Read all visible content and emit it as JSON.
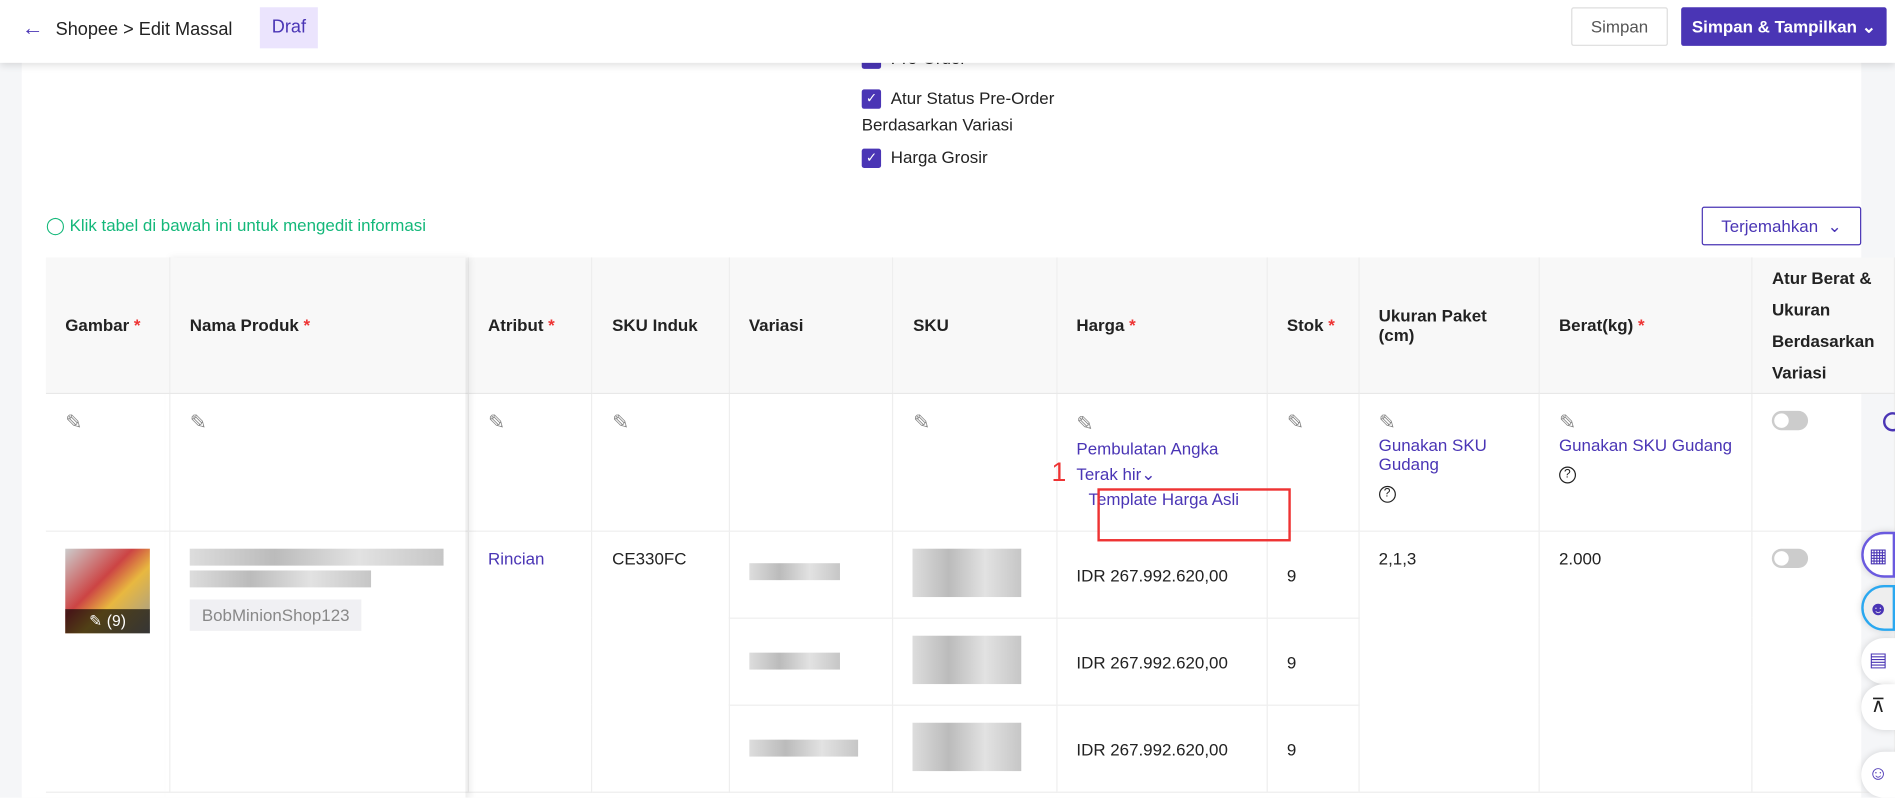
{
  "header": {
    "breadcrumb": "Shopee > Edit Massal",
    "status_badge": "Draf",
    "save_label": "Simpan",
    "save_show_label": "Simpan & Tampilkan"
  },
  "options": [
    {
      "label": "Pre-Order",
      "checked": true
    },
    {
      "label": "Atur Status Pre-Order",
      "label2": "Berdasarkan Variasi",
      "checked": true
    },
    {
      "label": "Harga Grosir",
      "checked": true
    }
  ],
  "tip": "Klik tabel di bawah ini untuk mengedit informasi",
  "translate_label": "Terjemahkan",
  "columns": [
    "Gambar",
    "Nama Produk",
    "Atribut",
    "SKU Induk",
    "Variasi",
    "SKU",
    "Harga",
    "Stok",
    "Ukuran Paket (cm)",
    "Berat(kg)",
    "Atur Berat & Ukuran Berdasarkan Variasi"
  ],
  "edit_row": {
    "rounding": "Pembulatan Angka Terak hir",
    "template": "Template Harga Asli",
    "warehouse_sku": "Gunakan SKU Gudang"
  },
  "annotation": "1",
  "product": {
    "image_count": "(9)",
    "shop": "BobMinionShop123",
    "attribute_link": "Rincian",
    "parent_sku": "CE330FC",
    "size": "2,1,3",
    "weight": "2.000",
    "variants": [
      {
        "price": "IDR 267.992.620,00",
        "stock": "9"
      },
      {
        "price": "IDR 267.992.620,00",
        "stock": "9"
      },
      {
        "price": "IDR 267.992.620,00",
        "stock": "9"
      }
    ]
  }
}
